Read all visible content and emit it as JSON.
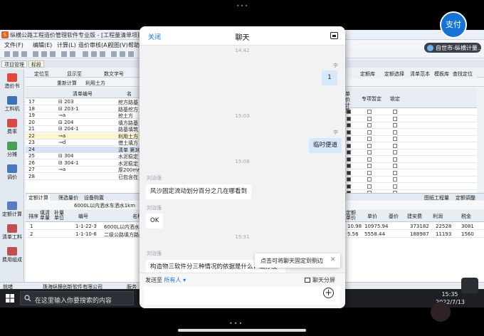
{
  "status": {
    "top_dots": "•••",
    "bottom_dots": "•••"
  },
  "app": {
    "title": "纵横公路工程造价管理软件专业版 - [工程量清单项目 - 2022071...]",
    "logo_letter": "S",
    "menu": [
      "文件(F)",
      "编辑(E)",
      "计算(L)",
      "造价审核(A)",
      "视图(V)",
      "帮助(H)",
      "工"
    ],
    "tab": "项目管理",
    "subtab": "标段",
    "sidebar": [
      "造价书",
      "工料机",
      "费率",
      "分摊",
      "调价",
      "定额计算",
      "清单工料",
      "费用组成"
    ],
    "hdr2": [
      "定位至",
      "显示至",
      "数文字号"
    ],
    "hdr3": [
      "重新计算",
      "利用土方"
    ],
    "grid_headers": [
      "",
      "清单编号",
      "名"
    ],
    "grid_rows": [
      {
        "n": "17",
        "c": "⊟ 203",
        "d": "挖方路基"
      },
      {
        "n": "18",
        "c": "⊟ 203-1",
        "d": "路基挖方"
      },
      {
        "n": "19",
        "c": "⊸a",
        "d": "挖土方"
      },
      {
        "n": "20",
        "c": "⊟ 204",
        "d": "填方路基"
      },
      {
        "n": "21",
        "c": "⊟ 204-1",
        "d": "路基填筑"
      },
      {
        "n": "22",
        "c": "⊸a",
        "d": "利用土方"
      },
      {
        "n": "23",
        "c": "⊸d",
        "d": "借土填方"
      },
      {
        "n": "24",
        "c": "",
        "d": "清单 第300"
      },
      {
        "n": "25",
        "c": "⊟ 304",
        "d": "水泥稳定"
      },
      {
        "n": "26",
        "c": "⊟ 304-1",
        "d": "水泥稳定"
      },
      {
        "n": "27",
        "c": "⊸a",
        "d": "厚200mm"
      },
      {
        "n": "28",
        "c": "",
        "d": "已包含在"
      }
    ],
    "right_toolbar": [
      "定额库",
      "定额选择",
      "清单范本",
      "模板库",
      "查找定位"
    ],
    "right_headers": [
      "单价计算",
      "专项暂定",
      "锁定"
    ],
    "bottom_tabs": [
      "定额计算",
      "筛选量价",
      "设备购置"
    ],
    "bottom_line": [
      "6000L以内洒水车洒水1km"
    ],
    "bottom_right_tabs": [
      "图纸工程量",
      "定额调整"
    ],
    "bottom_headers": [
      "排序",
      "填清单量",
      "补量单位",
      "编号",
      "名称",
      "定额单价",
      "单价",
      "基价",
      "建安费",
      "利润",
      "税金"
    ],
    "bottom_rows": [
      {
        "no": "1",
        "code": "1-1-22-3",
        "name": "6000L以内洒水车洒水1km",
        "price": "10.98",
        "unit": "10975.94",
        "base": "",
        "jaf": "373182",
        "lr": "22528",
        "sj": "3081"
      },
      {
        "no": "2",
        "code": "1-1-10-6",
        "name": "二级公路填方路基",
        "price": "5.56",
        "unit": "5558.44",
        "base": "",
        "jaf": "188987",
        "lr": "11193",
        "sj": "1560"
      }
    ],
    "statusbar": [
      "就绪",
      "珠海纵横创新软件有限公司",
      "服务"
    ],
    "taskbar_search": "在这里输入你要搜索的内容",
    "clock_time": "15:35",
    "clock_date": "2022/7/13",
    "remote_user": "自世市-纵横计量...",
    "pay_label": "支付"
  },
  "chat": {
    "close_label": "关闭",
    "title": "聊天",
    "messages": [
      {
        "type": "time",
        "text": "14:42"
      },
      {
        "type": "me",
        "sender": "李",
        "text": "1"
      },
      {
        "type": "time",
        "text": "15:03"
      },
      {
        "type": "me",
        "sender": "李",
        "text": "临时便道"
      },
      {
        "type": "time",
        "text": "15:08"
      },
      {
        "type": "them",
        "sender": "刘治强",
        "text": "风沙固定流动划分百分之几在哪看到"
      },
      {
        "type": "them",
        "sender": "刘治强",
        "text": "OK"
      },
      {
        "type": "time",
        "text": "15:31"
      },
      {
        "type": "them",
        "sender": "刘治强",
        "text": "构造物三软件分三种情况的依据是什么，编办没有这么分"
      }
    ],
    "tooltip": "点击可将聊天固定到侧边",
    "send_to_label": "发送至",
    "send_to_target": "所有人",
    "split_label": "聊天分屏"
  }
}
